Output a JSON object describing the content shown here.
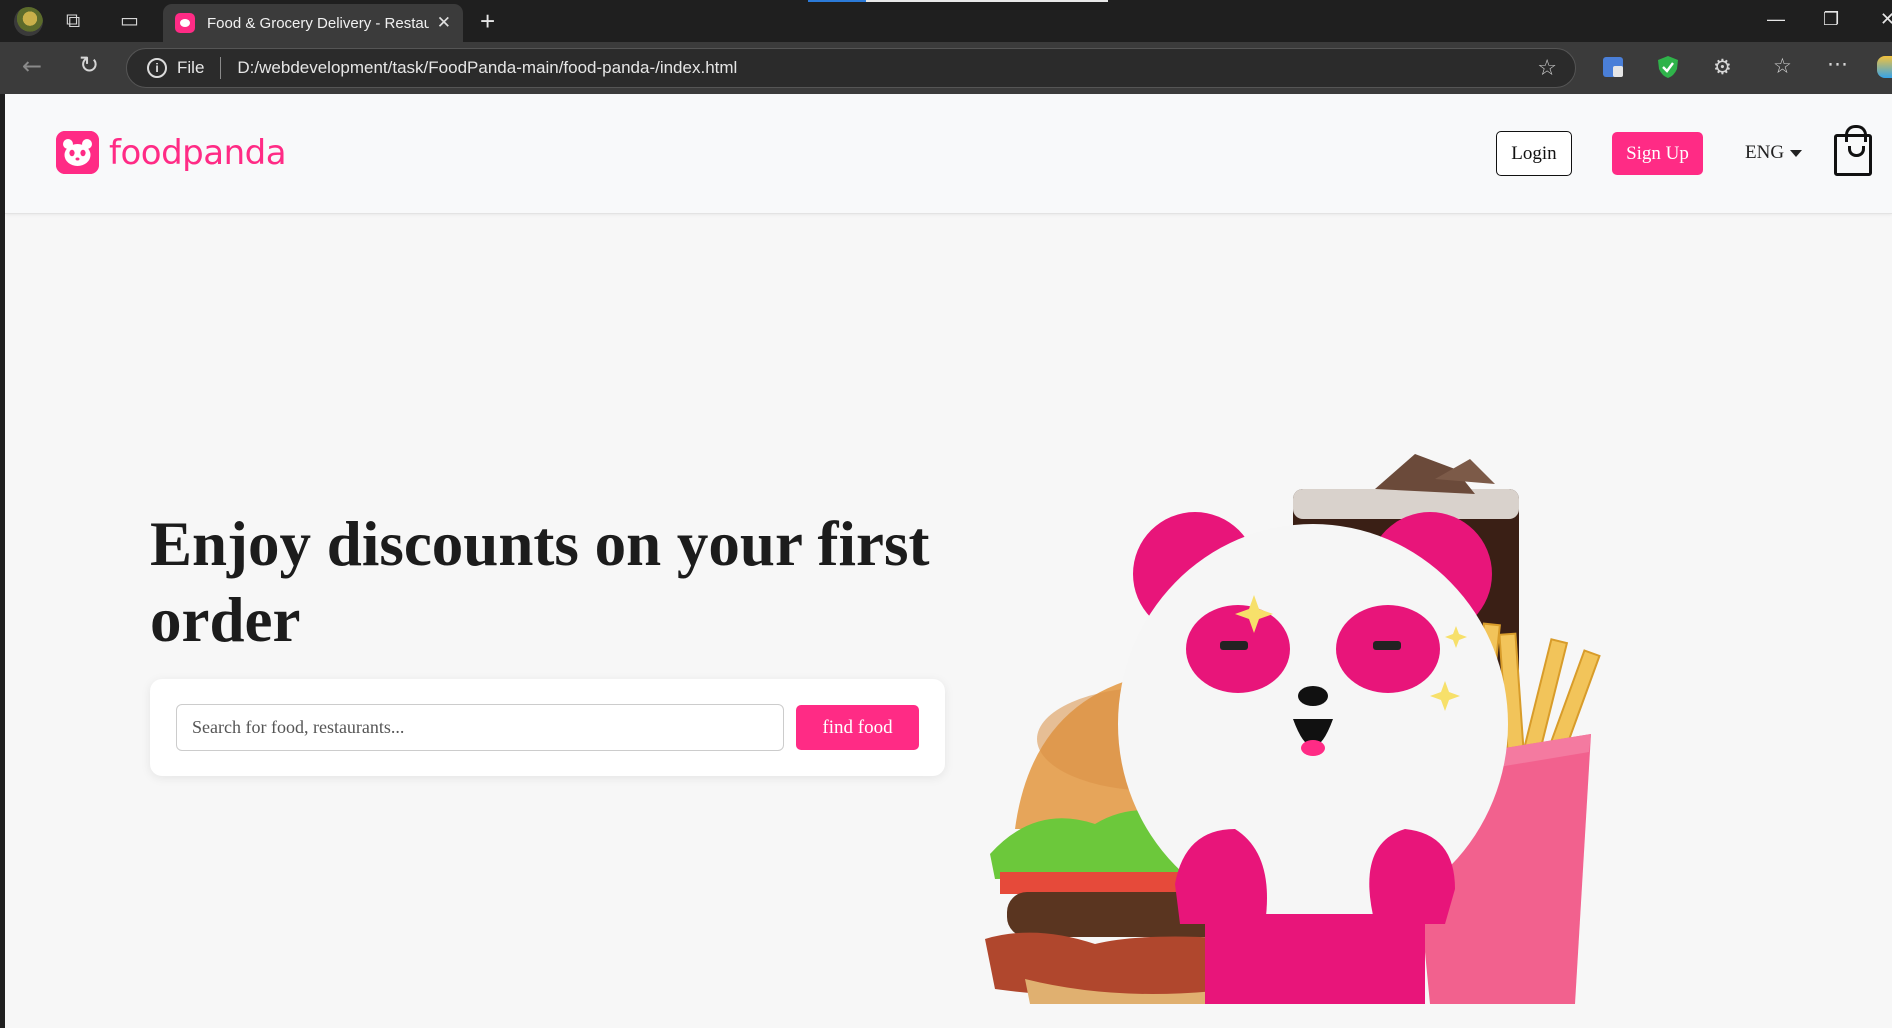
{
  "browser": {
    "tab_title": "Food & Grocery Delivery - Restau",
    "file_label": "File",
    "url": "D:/webdevelopment/task/FoodPanda-main/food-panda-/index.html"
  },
  "header": {
    "logo_text": "foodpanda",
    "login_label": "Login",
    "signup_label": "Sign Up",
    "language": "ENG"
  },
  "hero": {
    "title": "Enjoy discounts on your first order",
    "search_placeholder": "Search for food, restaurants...",
    "search_value": "",
    "find_button_label": "find food"
  },
  "colors": {
    "brand_pink": "#ff2b85",
    "page_background": "#f7f7f7",
    "header_background": "#f8f9fa"
  }
}
